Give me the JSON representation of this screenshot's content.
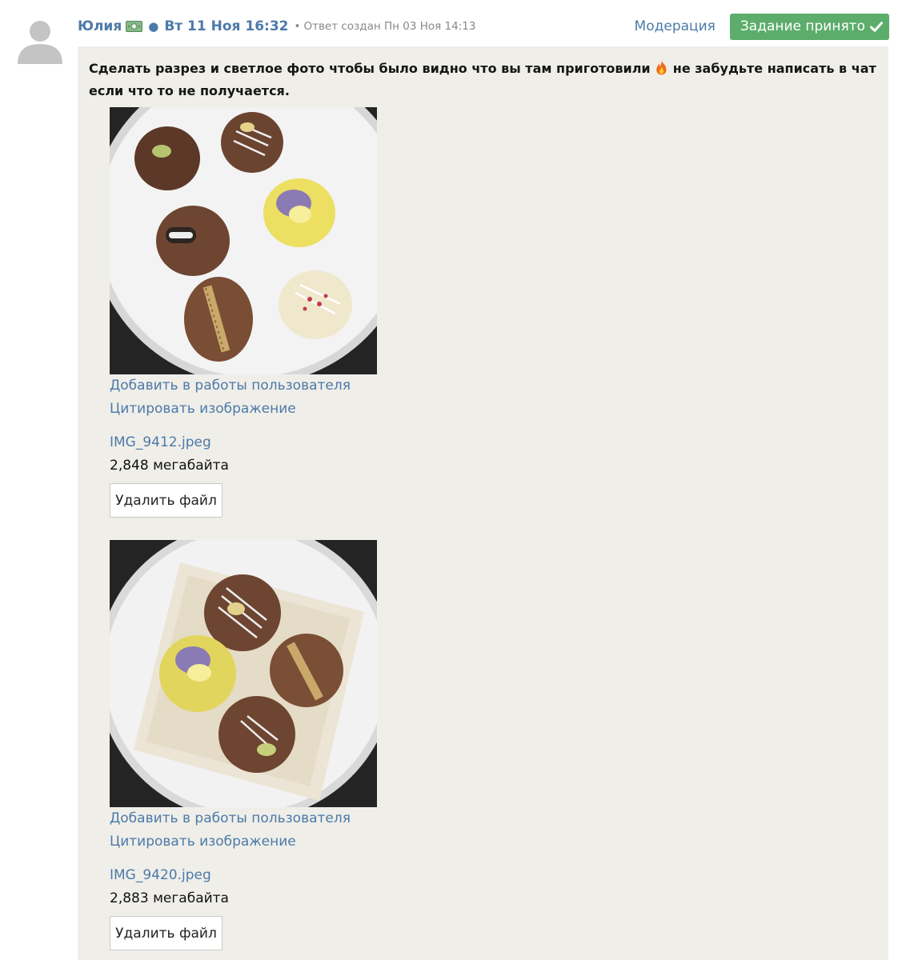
{
  "comment": {
    "author": "Юлия",
    "author_icon": "money-icon",
    "date": "Вт 11 Ноя 16:32",
    "created_label": "Ответ создан Пн 03 Ноя 14:13",
    "moderation_link": "Модерация",
    "status_button": "Задание принято",
    "status_color": "#5cad6b",
    "link_color": "#4d7aa8",
    "task_text_before": "Сделать разрез и светлое фото чтобы было видно что вы там приготовили",
    "task_emoji": "fire-icon",
    "task_text_after": "не забудьте написать в чат если что то не получается."
  },
  "attachments": [
    {
      "image_alt": "Конфеты на белой тарелке",
      "add_link": "Добавить в работы пользователя",
      "quote_link": "Цитировать изображение",
      "filename": "IMG_9412.jpeg",
      "size": "2,848 мегабайта",
      "delete_button": "Удалить файл"
    },
    {
      "image_alt": "Конфеты в коробке на тарелке",
      "add_link": "Добавить в работы пользователя",
      "quote_link": "Цитировать изображение",
      "filename": "IMG_9420.jpeg",
      "size": "2,883 мегабайта",
      "delete_button": "Удалить файл"
    }
  ]
}
